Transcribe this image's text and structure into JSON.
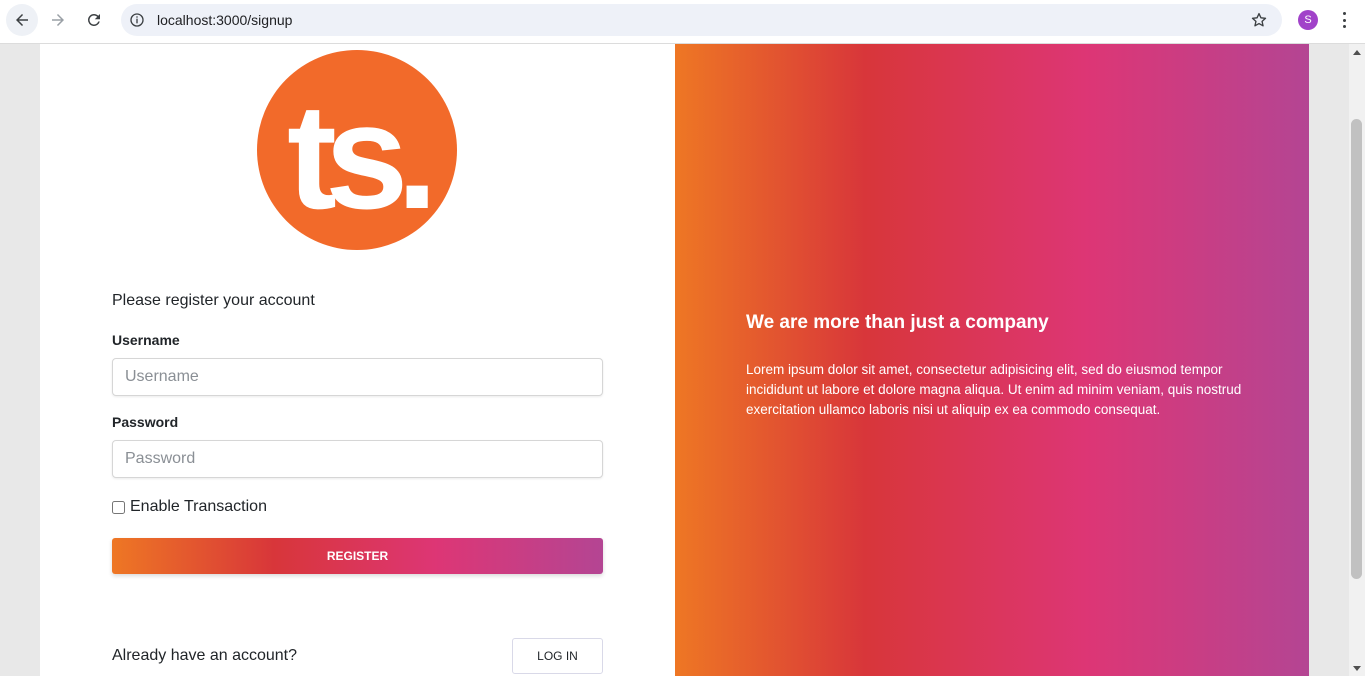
{
  "browser": {
    "url": "localhost:3000/signup",
    "profile_initial": "S",
    "profile_color": "#a142c9"
  },
  "logo": {
    "text": "ts.",
    "color": "#f26a2a"
  },
  "form": {
    "prompt": "Please register your account",
    "username_label": "Username",
    "username_placeholder": "Username",
    "password_label": "Password",
    "password_placeholder": "Password",
    "checkbox_label": "Enable Transaction",
    "checkbox_checked": false,
    "register_label": "REGISTER",
    "already_text": "Already have an account?",
    "login_label": "LOG IN"
  },
  "hero": {
    "title": "We are more than just a company",
    "body": "Lorem ipsum dolor sit amet, consectetur adipisicing elit, sed do eiusmod tempor incididunt ut labore et dolore magna aliqua. Ut enim ad minim veniam, quis nostrud exercitation ullamco laboris nisi ut aliquip ex ea commodo consequat."
  },
  "colors": {
    "gradient": [
      "#ee7724",
      "#d8363a",
      "#dd3675",
      "#b44593"
    ]
  }
}
